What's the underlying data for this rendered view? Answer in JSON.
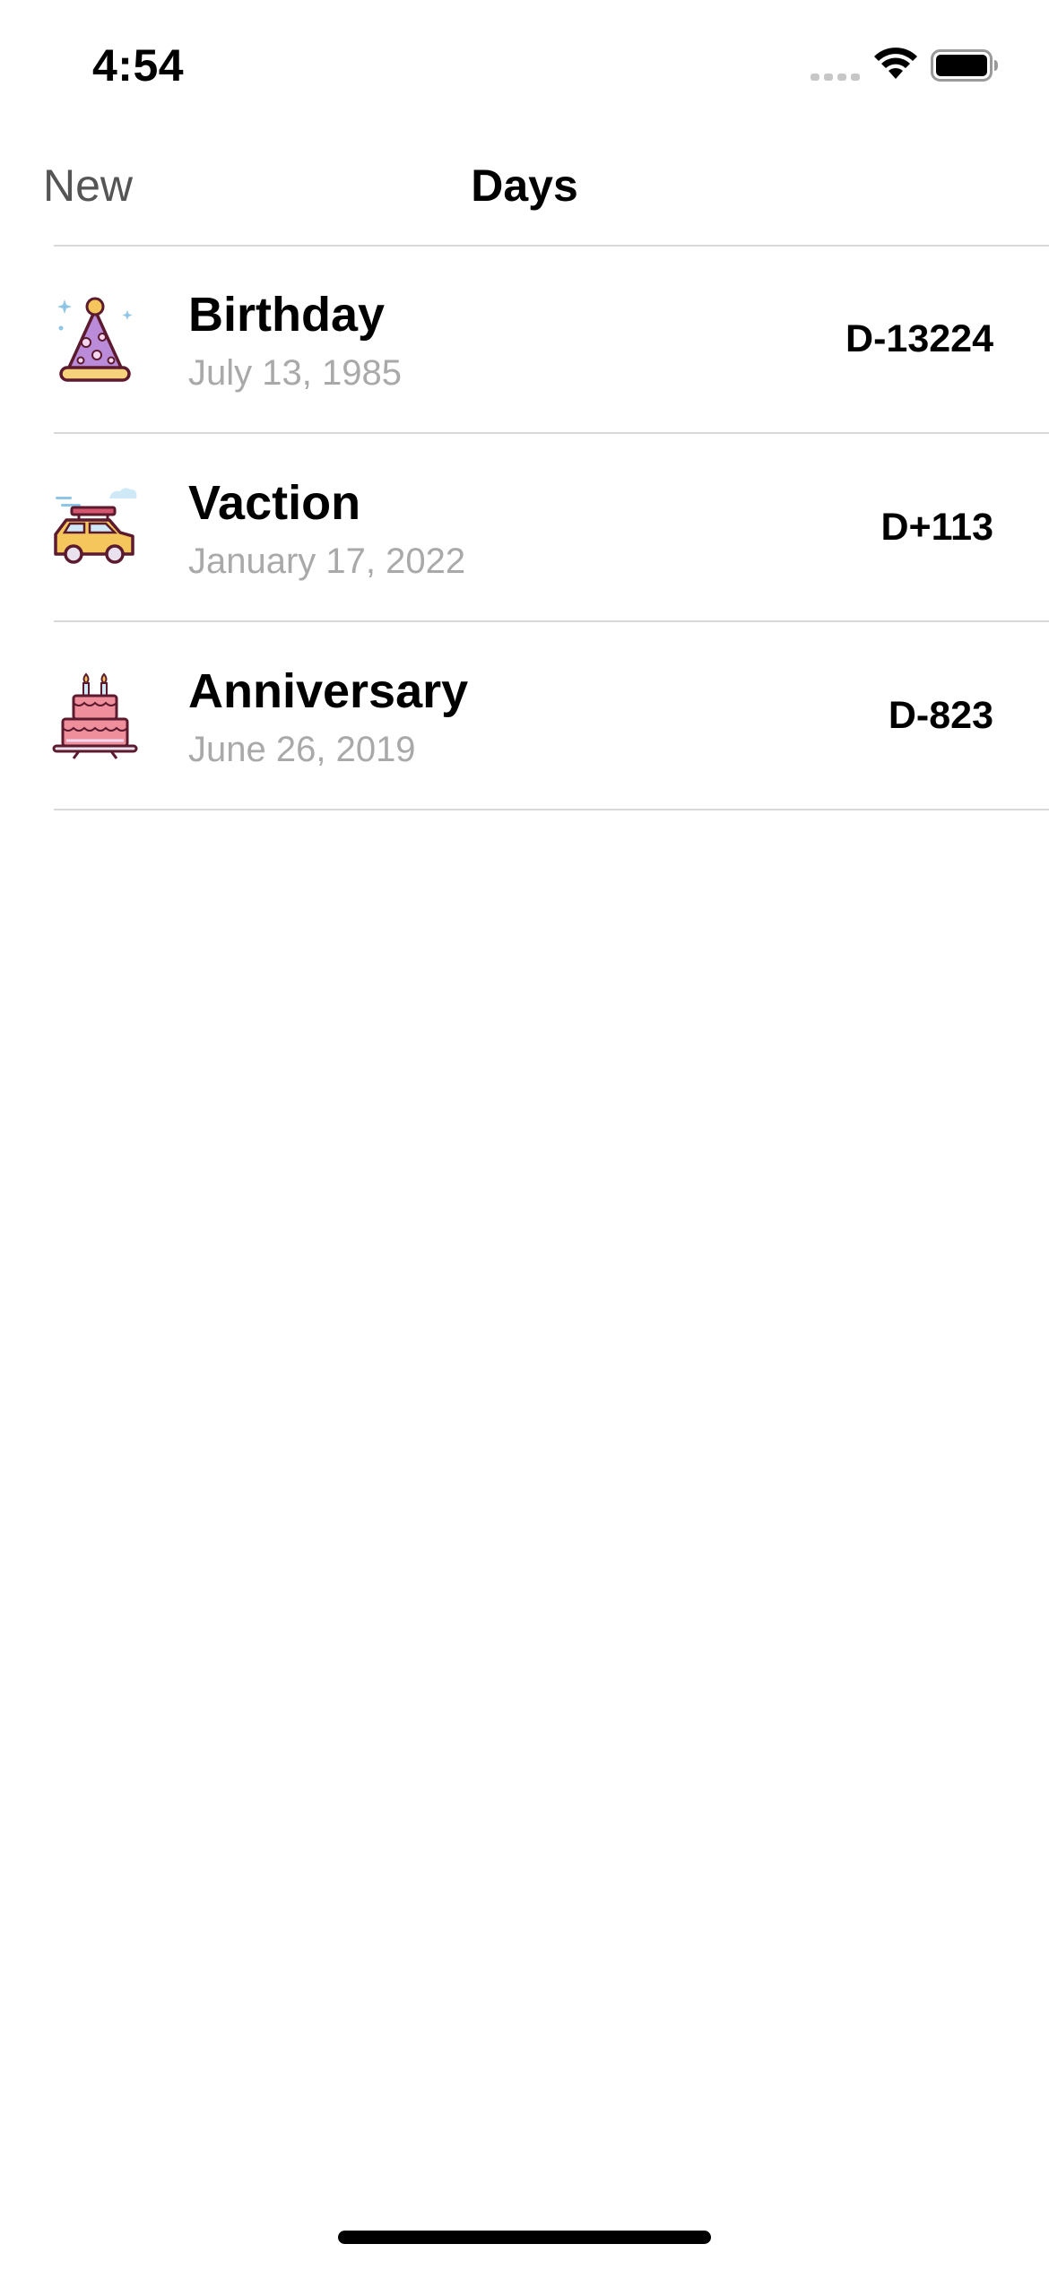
{
  "status_bar": {
    "time": "4:54",
    "icons": [
      "cellular-signal-icon",
      "wifi-icon",
      "battery-icon"
    ]
  },
  "nav": {
    "new_label": "New",
    "title": "Days"
  },
  "days": [
    {
      "title": "Birthday",
      "date": "July 13, 1985",
      "count": "D-13224",
      "icon": "party-hat-icon"
    },
    {
      "title": "Vaction",
      "date": "January 17, 2022",
      "count": "D+113",
      "icon": "car-icon"
    },
    {
      "title": "Anniversary",
      "date": "June 26, 2019",
      "count": "D-823",
      "icon": "cake-icon"
    }
  ],
  "colors": {
    "background": "#ffffff",
    "nav_button": "#555555",
    "secondary_text": "#a9a9a9",
    "divider": "#d9d9d9",
    "icon_outline": "#5b1a2e",
    "hat_purple": "#b98bd8",
    "car_yellow": "#f5c65b",
    "cake_pink": "#ef8f9c"
  }
}
